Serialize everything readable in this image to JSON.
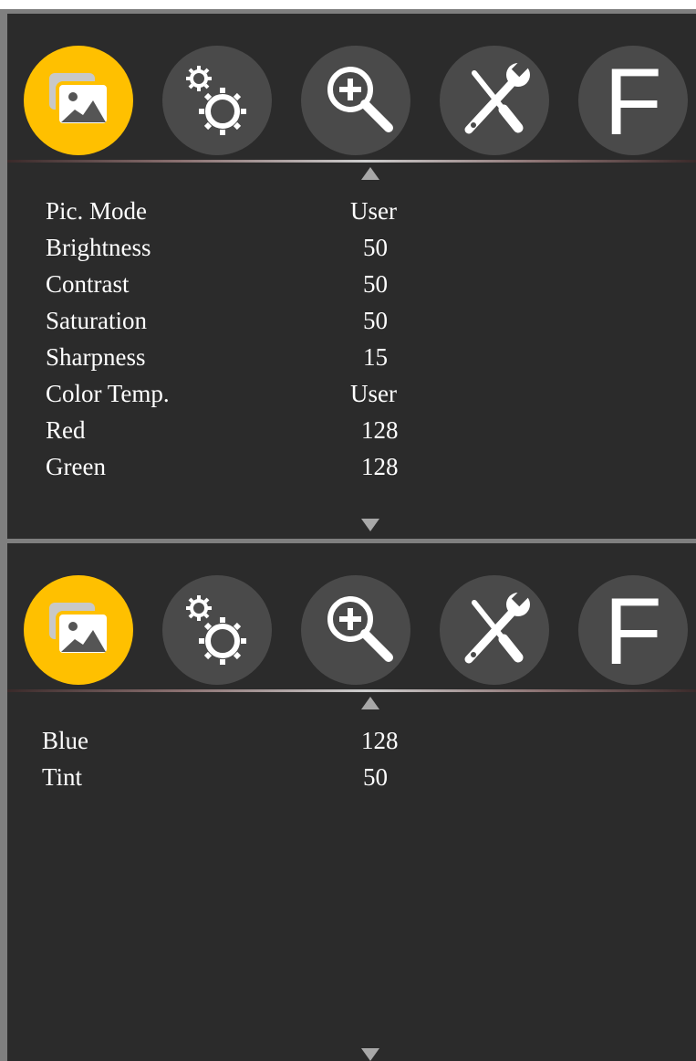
{
  "tabs": [
    {
      "id": "picture",
      "icon": "picture-icon",
      "active": true
    },
    {
      "id": "settings",
      "icon": "gears-icon",
      "active": false
    },
    {
      "id": "zoom",
      "icon": "zoom-in-icon",
      "active": false
    },
    {
      "id": "tools",
      "icon": "tools-icon",
      "active": false
    },
    {
      "id": "function",
      "icon": "function-icon",
      "label": "F",
      "active": false
    }
  ],
  "colors": {
    "active_tab": "#ffc000",
    "inactive_tab": "#4a4a4a",
    "panel_bg": "#2b2b2b",
    "text": "#ffffff",
    "scroll_arrow": "#a8a8a8"
  },
  "page1": {
    "items": [
      {
        "label": "Pic. Mode",
        "value": "User"
      },
      {
        "label": "Brightness",
        "value": "50"
      },
      {
        "label": "Contrast",
        "value": "50"
      },
      {
        "label": "Saturation",
        "value": "50"
      },
      {
        "label": "Sharpness",
        "value": "15"
      },
      {
        "label": "Color Temp.",
        "value": "User"
      },
      {
        "label": "Red",
        "value": "128"
      },
      {
        "label": "Green",
        "value": "128"
      }
    ]
  },
  "page2": {
    "items": [
      {
        "label": "Blue",
        "value": "128"
      },
      {
        "label": "Tint",
        "value": "50"
      }
    ]
  }
}
